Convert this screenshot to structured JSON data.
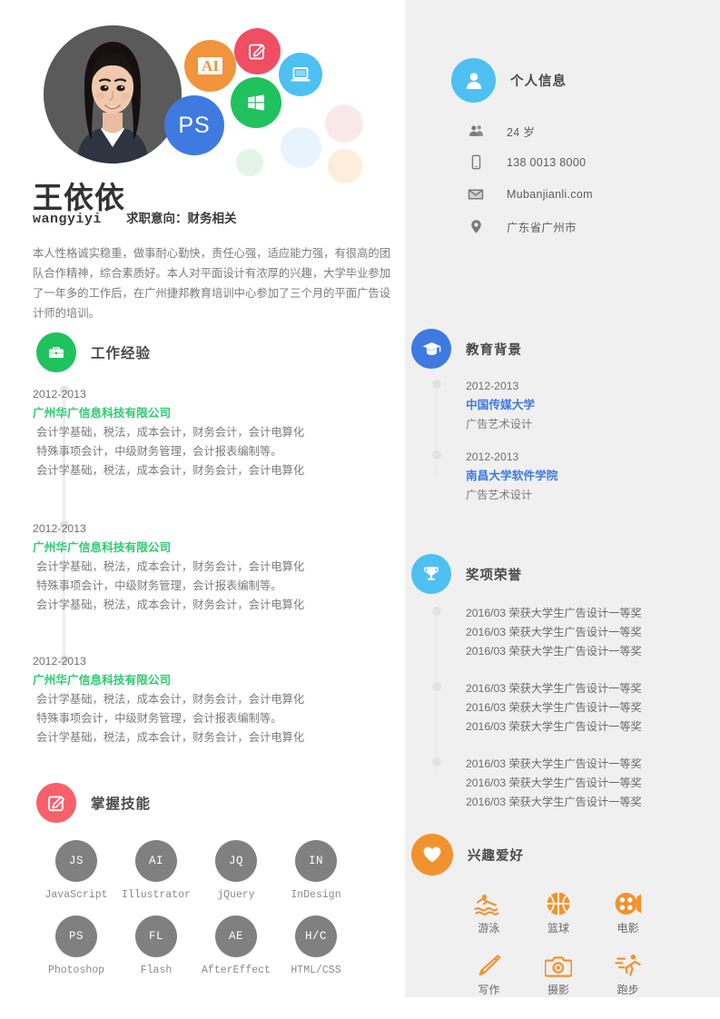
{
  "profile": {
    "name_cn": "王依依",
    "name_en": "wangyiyi",
    "objective": "求职意向：财务相关",
    "summary": "本人性格诚实稳重，做事耐心勤快，责任心强，适应能力强，有很高的团队合作精神，综合素质好。本人对平面设计有浓厚的兴趣，大学毕业参加了一年多的工作后，在广州捷邦教育培训中心参加了三个月的平面广告设计师的培训。",
    "avatar_alt": "portrait-photo"
  },
  "badges": [
    {
      "name": "illustrator-badge",
      "label": "AI",
      "color": "#f0943d"
    },
    {
      "name": "pen-badge",
      "label": "",
      "color": "#ef4e63"
    },
    {
      "name": "laptop-badge",
      "label": "",
      "color": "#4ec0f2"
    },
    {
      "name": "windows-badge",
      "label": "",
      "color": "#1fc25f"
    },
    {
      "name": "photoshop-badge",
      "label": "PS",
      "color": "#3e7ae0"
    }
  ],
  "sections": {
    "work": {
      "title": "工作经验",
      "icon": "briefcase-icon",
      "color": "#1fc25f"
    },
    "skills": {
      "title": "掌握技能",
      "icon": "pencil-square-icon",
      "color": "#f8606c"
    },
    "personal": {
      "title": "个人信息",
      "icon": "person-icon",
      "color": "#4ec0f2"
    },
    "education": {
      "title": "教育背景",
      "icon": "graduation-cap-icon",
      "color": "#3e7ae0"
    },
    "awards": {
      "title": "奖项荣誉",
      "icon": "trophy-icon",
      "color": "#4ec0f2"
    },
    "hobbies": {
      "title": "兴趣爱好",
      "icon": "heart-icon",
      "color": "#f2922e"
    }
  },
  "personal_info": [
    {
      "icon": "people-icon",
      "value": "24 岁"
    },
    {
      "icon": "phone-icon",
      "value": "138 0013 8000"
    },
    {
      "icon": "mail-icon",
      "value": "Mubanjianli.com"
    },
    {
      "icon": "location-pin-icon",
      "value": "广东省广州市"
    }
  ],
  "work_experience": [
    {
      "date": "2012-2013",
      "company": "广州华广信息科技有限公司",
      "lines": [
        "会计学基础，税法，成本会计，财务会计，会计电算化",
        "特殊事项会计，中级财务管理，会计报表编制等。",
        "会计学基础，税法，成本会计，财务会计，会计电算化"
      ]
    },
    {
      "date": "2012-2013",
      "company": "广州华广信息科技有限公司",
      "lines": [
        "会计学基础，税法，成本会计，财务会计，会计电算化",
        "特殊事项会计，中级财务管理，会计报表编制等。",
        "会计学基础，税法，成本会计，财务会计，会计电算化"
      ]
    },
    {
      "date": "2012-2013",
      "company": "广州华广信息科技有限公司",
      "lines": [
        "会计学基础，税法，成本会计，财务会计，会计电算化",
        "特殊事项会计，中级财务管理，会计报表编制等。",
        "会计学基础，税法，成本会计，财务会计，会计电算化"
      ]
    }
  ],
  "skills": [
    {
      "abbr": "JS",
      "name": "JavaScript"
    },
    {
      "abbr": "AI",
      "name": "Illustrator"
    },
    {
      "abbr": "JQ",
      "name": "jQuery"
    },
    {
      "abbr": "IN",
      "name": "InDesign"
    },
    {
      "abbr": "PS",
      "name": "Photoshop"
    },
    {
      "abbr": "FL",
      "name": "Flash"
    },
    {
      "abbr": "AE",
      "name": "AfterEffect"
    },
    {
      "abbr": "H/C",
      "name": "HTML/CSS"
    }
  ],
  "education": [
    {
      "date": "2012-2013",
      "school": "中国传媒大学",
      "major": "广告艺术设计"
    },
    {
      "date": "2012-2013",
      "school": "南昌大学软件学院",
      "major": "广告艺术设计"
    }
  ],
  "awards": [
    [
      "2016/03 荣获大学生广告设计一等奖",
      "2016/03 荣获大学生广告设计一等奖",
      "2016/03 荣获大学生广告设计一等奖"
    ],
    [
      "2016/03 荣获大学生广告设计一等奖",
      "2016/03 荣获大学生广告设计一等奖",
      "2016/03 荣获大学生广告设计一等奖"
    ],
    [
      "2016/03 荣获大学生广告设计一等奖",
      "2016/03 荣获大学生广告设计一等奖",
      "2016/03 荣获大学生广告设计一等奖"
    ]
  ],
  "hobbies": [
    {
      "icon": "swimming-icon",
      "name": "游泳"
    },
    {
      "icon": "basketball-icon",
      "name": "篮球"
    },
    {
      "icon": "film-reel-icon",
      "name": "电影"
    },
    {
      "icon": "pencil-icon",
      "name": "写作"
    },
    {
      "icon": "camera-icon",
      "name": "摄影"
    },
    {
      "icon": "running-icon",
      "name": "跑步"
    }
  ],
  "colors": {
    "page_bg": "#ffffff",
    "panel_bg": "#f0f0f0",
    "green": "#1fc25f",
    "blue": "#3e7ae0",
    "cyan": "#4ec0f2",
    "orange": "#f2922e",
    "red": "#f8606c",
    "company_green": "#2ecc71",
    "timeline": "#ededed"
  }
}
